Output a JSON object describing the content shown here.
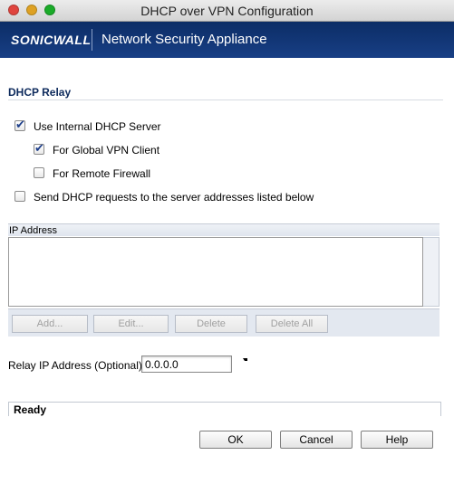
{
  "window": {
    "title": "DHCP over VPN Configuration"
  },
  "brand": {
    "logo": "SONICWALL",
    "title": "Network Security Appliance"
  },
  "section": {
    "title": "DHCP Relay"
  },
  "options": {
    "use_internal": {
      "label": "Use Internal DHCP Server",
      "checked": true
    },
    "global_vpn": {
      "label": "For Global VPN Client",
      "checked": true
    },
    "remote_firewall": {
      "label": "For Remote Firewall",
      "checked": false
    },
    "send_requests": {
      "label": "Send DHCP requests to the server addresses listed below",
      "checked": false
    }
  },
  "ip_table": {
    "header": "IP Address",
    "rows": [],
    "buttons": {
      "add": "Add...",
      "edit": "Edit...",
      "delete": "Delete",
      "delete_all": "Delete All"
    }
  },
  "relay": {
    "label": "Relay IP Address (Optional):",
    "value": "0.0.0.0"
  },
  "status": {
    "text": "Ready"
  },
  "footer": {
    "ok": "OK",
    "cancel": "Cancel",
    "help": "Help"
  }
}
